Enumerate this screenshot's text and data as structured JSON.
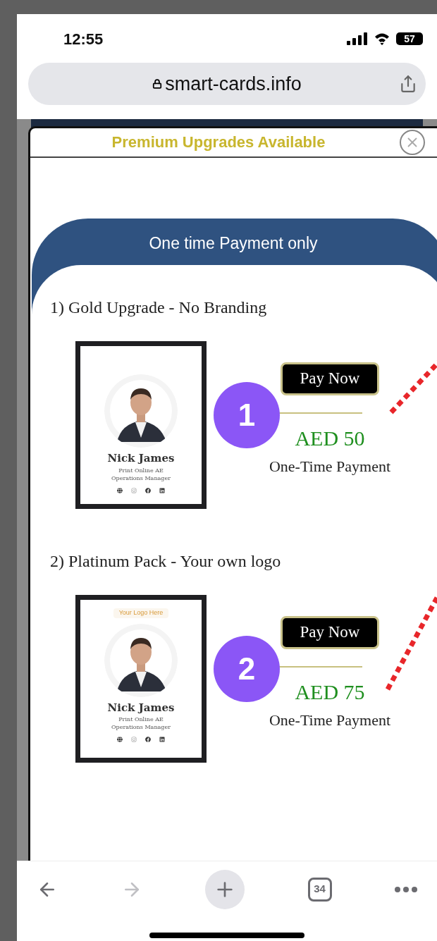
{
  "status_bar": {
    "time": "12:55",
    "battery": "57"
  },
  "address_bar": {
    "url": "smart-cards.info"
  },
  "modal": {
    "title": "Premium Upgrades Available",
    "banner": "One time Payment only",
    "offers": [
      {
        "heading": "1) Gold Upgrade - No Branding",
        "card": {
          "name": "Nick James",
          "company": "Print Online AE",
          "role": "Operations Manager"
        },
        "button": "Pay Now",
        "price": "AED 50",
        "note": "One-Time Payment",
        "badge": "1"
      },
      {
        "heading": "2) Platinum Pack - Your own logo",
        "card": {
          "logo": "Your Logo Here",
          "name": "Nick James",
          "company": "Print Online AE",
          "role": "Operations Manager"
        },
        "button": "Pay Now",
        "price": "AED 75",
        "note": "One-Time Payment",
        "badge": "2"
      }
    ]
  },
  "toolbar": [
    {
      "kind": "back",
      "disabled": false
    },
    {
      "kind": "forward",
      "disabled": true
    },
    {
      "kind": "new-tab",
      "disabled": false
    },
    {
      "kind": "tabs",
      "label": "34",
      "disabled": false
    },
    {
      "kind": "more",
      "disabled": false
    }
  ]
}
